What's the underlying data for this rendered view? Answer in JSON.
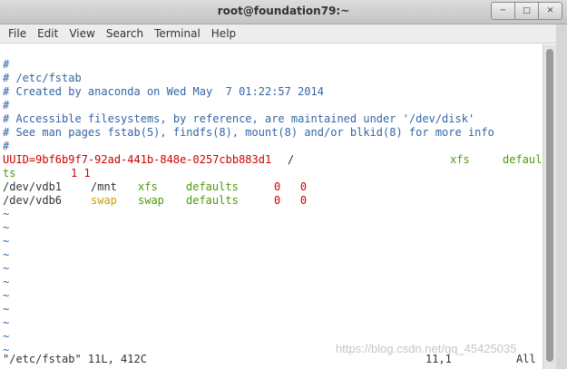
{
  "window": {
    "title": "root@foundation79:~",
    "buttons": [
      "minimize-icon",
      "maximize-icon",
      "close-icon"
    ]
  },
  "menu": [
    "File",
    "Edit",
    "View",
    "Search",
    "Terminal",
    "Help"
  ],
  "lines": {
    "c1": "#",
    "c2": "# /etc/fstab",
    "c3": "# Created by anaconda on Wed May  7 01:22:57 2014",
    "c4": "#",
    "c5": "# Accessible filesystems, by reference, are maintained under '/dev/disk'",
    "c6": "# See man pages fstab(5), findfs(8), mount(8) and/or blkid(8) for more info",
    "c7": "#",
    "uuid_device": "UUID=9bf6b9f7-92ad-441b-848e-0257cbb883d1",
    "uuid_mount": "/",
    "uuid_fs": "xfs",
    "uuid_opt_a": "defaul",
    "uuid_opt_b": "ts",
    "uuid_nums": "1 1",
    "vdb1_device": "/dev/vdb1",
    "vdb1_mount": "/mnt",
    "vdb1_fs": "xfs",
    "vdb1_opt": "defaults",
    "vdb1_nums": "0   0",
    "vdb6_device": "/dev/vdb6",
    "vdb6_mount": "swap",
    "vdb6_fs": "swap",
    "vdb6_opt": "defaults",
    "vdb6_nums": "0   0",
    "tilde": "~"
  },
  "status": {
    "file": "\"/etc/fstab\" 11L, 412C",
    "position": "11,1",
    "scroll": "All"
  },
  "watermark": "https://blog.csdn.net/qq_45425035",
  "colors": {
    "comment": "#3465a4",
    "uuid": "#cc0000",
    "fs": "#4e9a06",
    "swap": "#c4a000",
    "numbers": "#cc0000"
  }
}
